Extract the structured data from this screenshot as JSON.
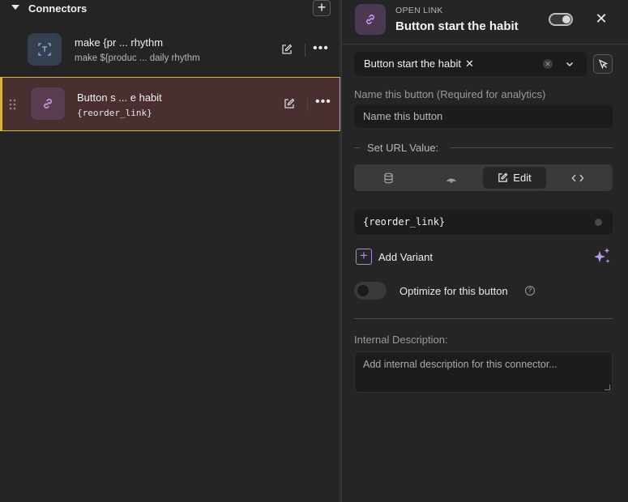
{
  "connectors": {
    "title": "Connectors",
    "add_label": "+",
    "items": [
      {
        "title": "make {pr ... rhythm",
        "subtitle": "make ${produc ... daily rhythm",
        "icon": "text-transform-icon"
      },
      {
        "title": "Button s ... e habit",
        "subtitle": "{reorder_link}",
        "icon": "link-icon"
      }
    ],
    "more_label": "•••"
  },
  "panel": {
    "kicker": "OPEN LINK",
    "title": "Button start the habit",
    "close_label": "✕",
    "selector": {
      "chip": "Button start the habit",
      "chip_remove": "✕",
      "clear": "✕"
    },
    "name_label": "Name this button (Required for analytics)",
    "name_placeholder": "Name this button",
    "url_section": "Set URL Value:",
    "url_tabs": [
      "database",
      "signal",
      "Edit",
      "code"
    ],
    "edit_label": "Edit",
    "url_value": "{reorder_link}",
    "add_variant_label": "Add Variant",
    "add_variant_icon": "+",
    "optimize_label": "Optimize for this button",
    "help_label": "?",
    "desc_label": "Internal Description:",
    "desc_placeholder": "Add internal description for this connector..."
  },
  "colors": {
    "accent": "#a78bda",
    "selected_bg": "#4a2f30",
    "selected_border": "#d9b34a"
  }
}
